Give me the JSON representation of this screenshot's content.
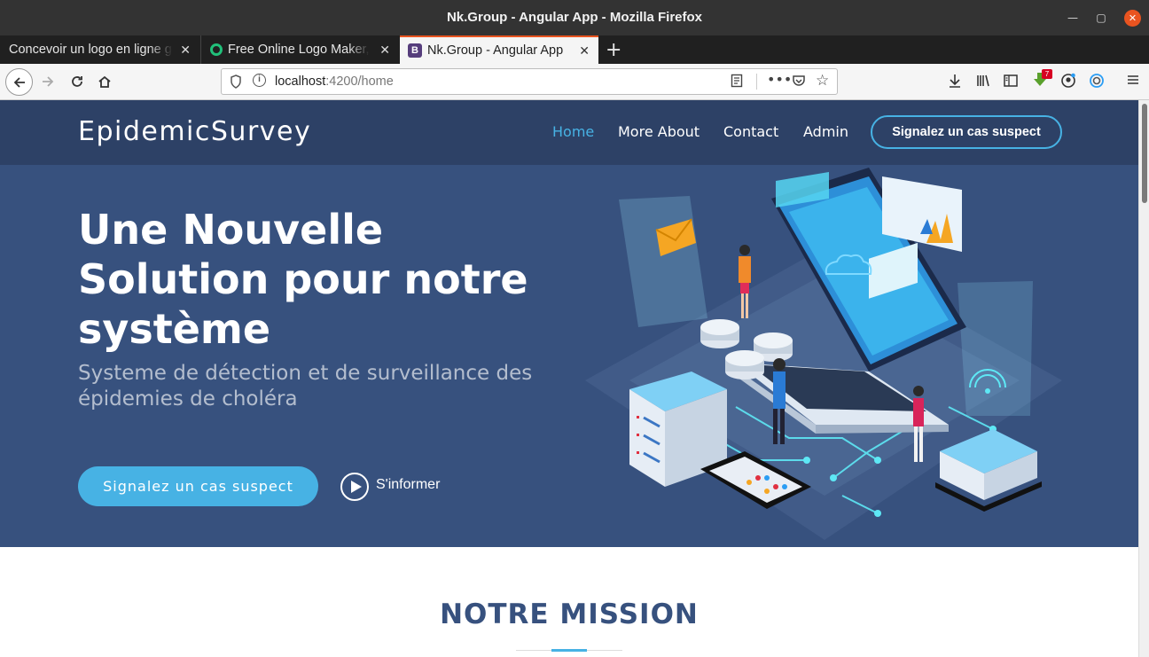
{
  "window": {
    "title": "Nk.Group - Angular App - Mozilla Firefox"
  },
  "tabs": [
    {
      "label": "Concevoir un logo en ligne gratuit"
    },
    {
      "label": "Free Online Logo Maker, Logo"
    },
    {
      "label": "Nk.Group - Angular App"
    }
  ],
  "navbar": {
    "url_host": "localhost",
    "url_rest": ":4200/home",
    "notification_badge": "7"
  },
  "site": {
    "brand": "EpidemicSurvey",
    "menu": [
      {
        "label": "Home",
        "active": true
      },
      {
        "label": "More About",
        "active": false
      },
      {
        "label": "Contact",
        "active": false
      },
      {
        "label": "Admin",
        "active": false
      }
    ],
    "nav_cta": "Signalez un cas suspect"
  },
  "hero": {
    "title": "Une Nouvelle Solution pour notre système",
    "subtitle": "Systeme de détection et de surveillance des épidemies de choléra",
    "cta": "Signalez un cas suspect",
    "inform": "S'informer"
  },
  "mission": {
    "title": "NOTRE MISSION"
  },
  "colors": {
    "hero_bg": "#37517e",
    "nav_bg": "#2d4166",
    "accent": "#47b2e4",
    "firefox_accent": "#e95420"
  },
  "icons": [
    "back-icon",
    "forward-icon",
    "reload-icon",
    "home-icon",
    "shield-icon",
    "info-icon",
    "reader-icon",
    "more-icon",
    "pocket-icon",
    "star-icon",
    "download-icon",
    "library-icon",
    "sidebar-icon",
    "extension-icon",
    "account-icon",
    "sync-icon",
    "menu-icon",
    "play-icon"
  ]
}
